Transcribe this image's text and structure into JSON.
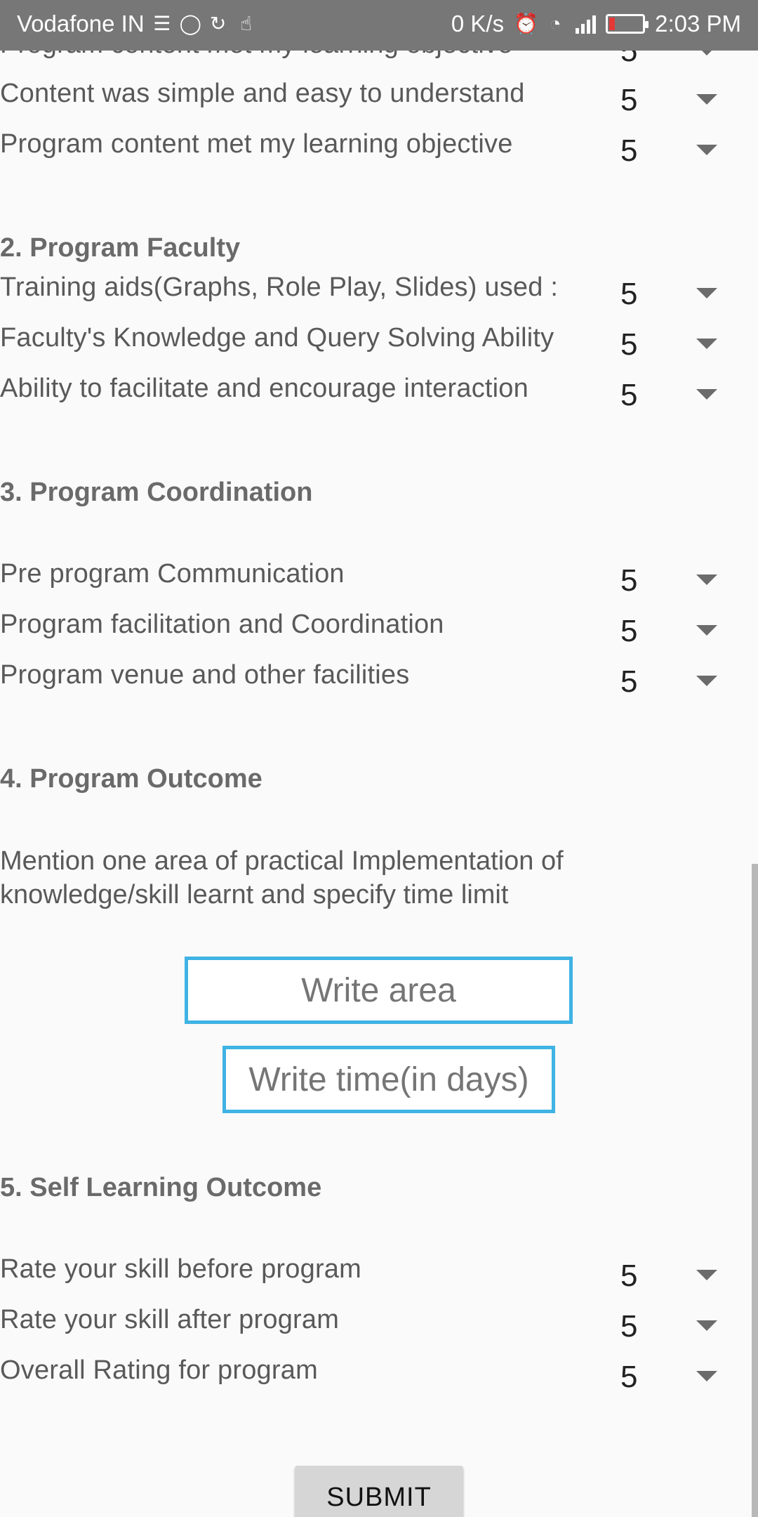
{
  "status_bar": {
    "carrier": "Vodafone IN",
    "net_speed": "0 K/s",
    "time": "2:03 PM"
  },
  "partial_top_row": {
    "label": "Program content met my learning objective",
    "value": "5"
  },
  "section1": {
    "rows": [
      {
        "label": "Content was simple and easy to understand",
        "value": "5"
      },
      {
        "label": "Program content met my learning objective",
        "value": "5"
      }
    ]
  },
  "section2": {
    "title": "2. Program Faculty",
    "rows": [
      {
        "label": "Training aids(Graphs, Role Play, Slides) used :",
        "value": "5"
      },
      {
        "label": "Faculty's Knowledge and Query Solving Ability",
        "value": "5"
      },
      {
        "label": "Ability to facilitate and encourage interaction",
        "value": "5"
      }
    ]
  },
  "section3": {
    "title": "3. Program Coordination",
    "rows": [
      {
        "label": "Pre program Communication",
        "value": "5"
      },
      {
        "label": "Program facilitation and Coordination",
        "value": "5"
      },
      {
        "label": "Program venue and other facilities",
        "value": "5"
      }
    ]
  },
  "section4": {
    "title": "4. Program Outcome",
    "description": "Mention one area of practical Implementation of knowledge/skill learnt and specify time limit",
    "area_placeholder": "Write area",
    "time_placeholder": "Write time(in days)"
  },
  "section5": {
    "title": "5. Self Learning Outcome",
    "rows": [
      {
        "label": "Rate your skill before program",
        "value": "5"
      },
      {
        "label": "Rate your skill after program",
        "value": "5"
      },
      {
        "label": "Overall Rating for program",
        "value": "5"
      }
    ]
  },
  "submit_label": "SUBMIT",
  "colors": {
    "status_bar": "#777777",
    "input_border": "#3fb3e3",
    "background": "#fafafa"
  }
}
